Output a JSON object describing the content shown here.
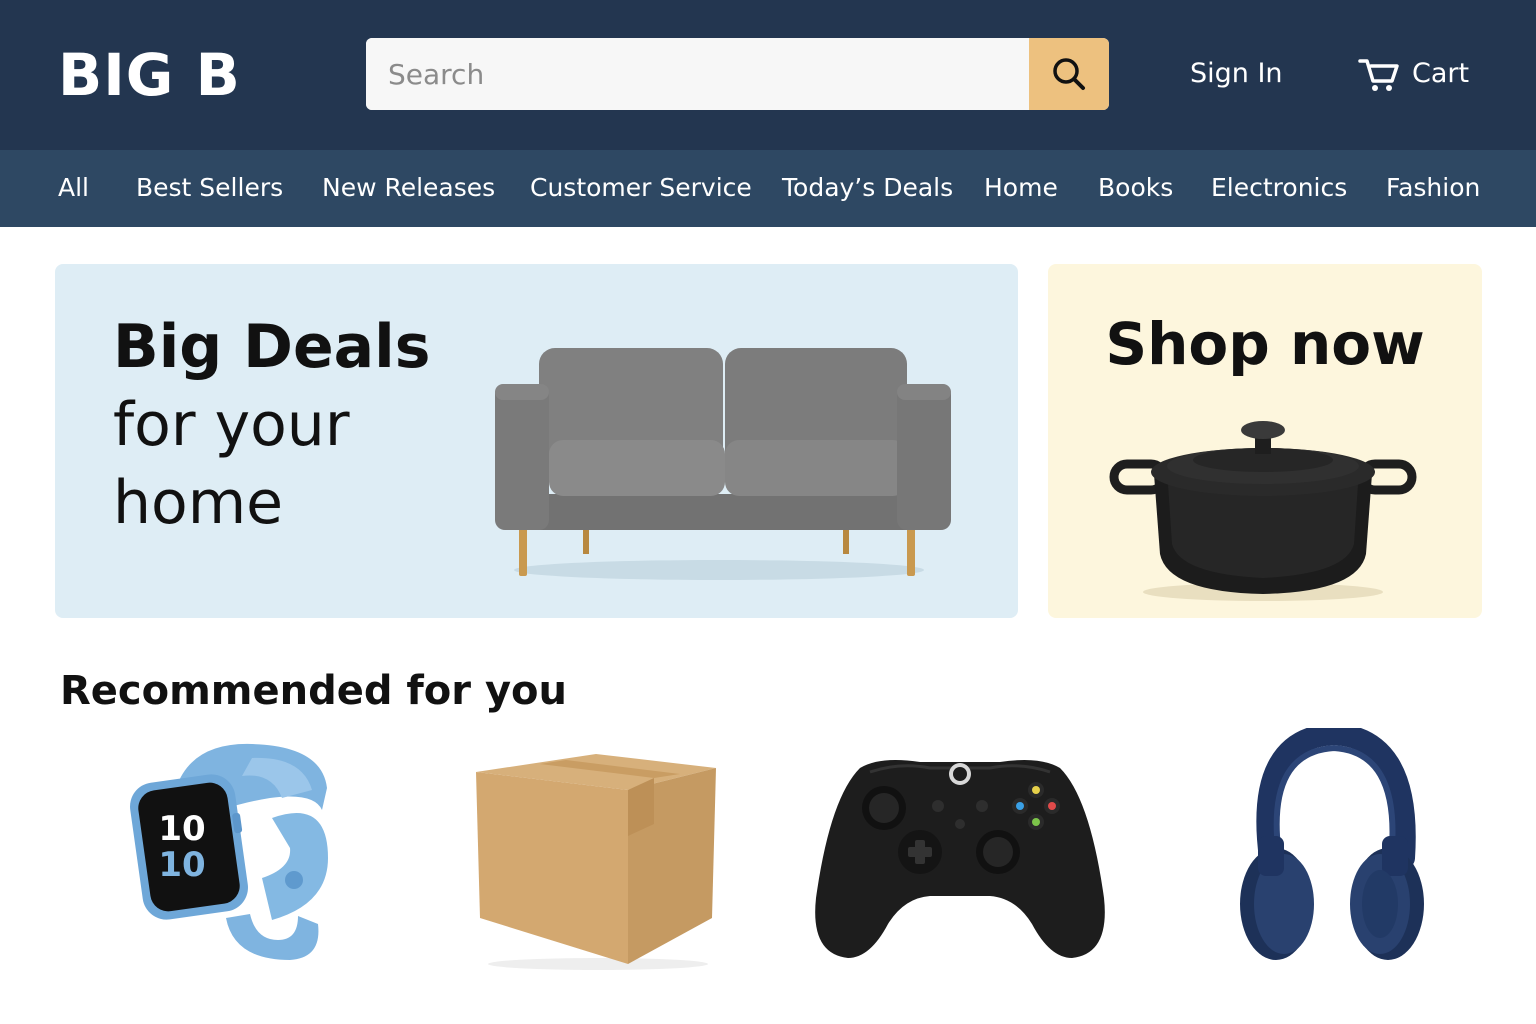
{
  "header": {
    "logo": "BIG B",
    "search_placeholder": "Search",
    "sign_in": "Sign In",
    "cart": "Cart"
  },
  "nav": {
    "items": [
      "All",
      "Best Sellers",
      "New Releases",
      "Customer Service",
      "Today’s Deals",
      "Home",
      "Books",
      "Electronics",
      "Fashion"
    ]
  },
  "hero": {
    "title_line1": "Big Deals",
    "title_line2": "for your",
    "title_line3": "home",
    "image": "sofa"
  },
  "promo": {
    "title": "Shop now",
    "image": "cooking-pot"
  },
  "recommended": {
    "title": "Recommended for you",
    "products": [
      {
        "name": "smartwatch",
        "watch_hour": "10",
        "watch_minute": "10"
      },
      {
        "name": "cardboard-box"
      },
      {
        "name": "game-controller"
      },
      {
        "name": "headphones"
      }
    ]
  },
  "colors": {
    "header_bg": "#233650",
    "nav_bg": "#2e4863",
    "search_button": "#edc17f",
    "hero_bg": "#deedf5",
    "promo_bg": "#fdf6dd"
  }
}
